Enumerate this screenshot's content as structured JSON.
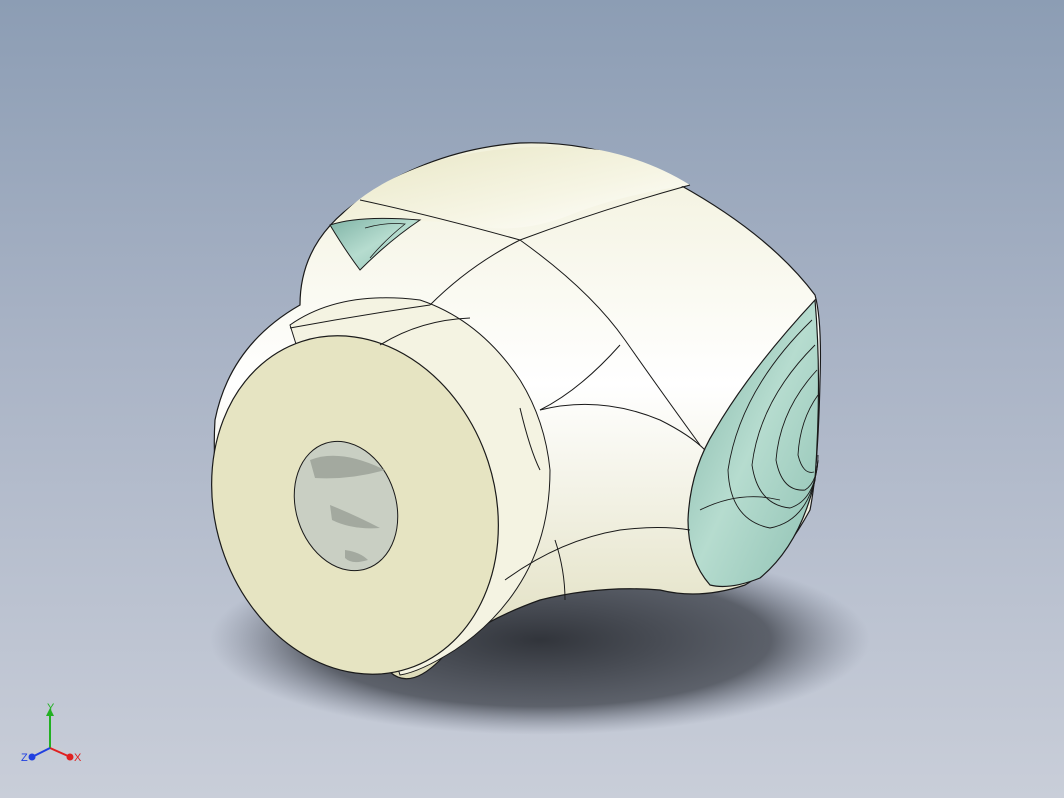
{
  "viewport": {
    "background_top": "#8c9db4",
    "background_bottom": "#c9ced9"
  },
  "model": {
    "body_color": "#ecebcf",
    "face_color": "#e6e4c2",
    "cavity_color": "#a9d2c6",
    "edge_color": "#1a1a1a"
  },
  "triad": {
    "x_label": "X",
    "y_label": "Y",
    "z_label": "Z",
    "x_color": "#e02020",
    "y_color": "#22b022",
    "z_color": "#2040e0"
  }
}
